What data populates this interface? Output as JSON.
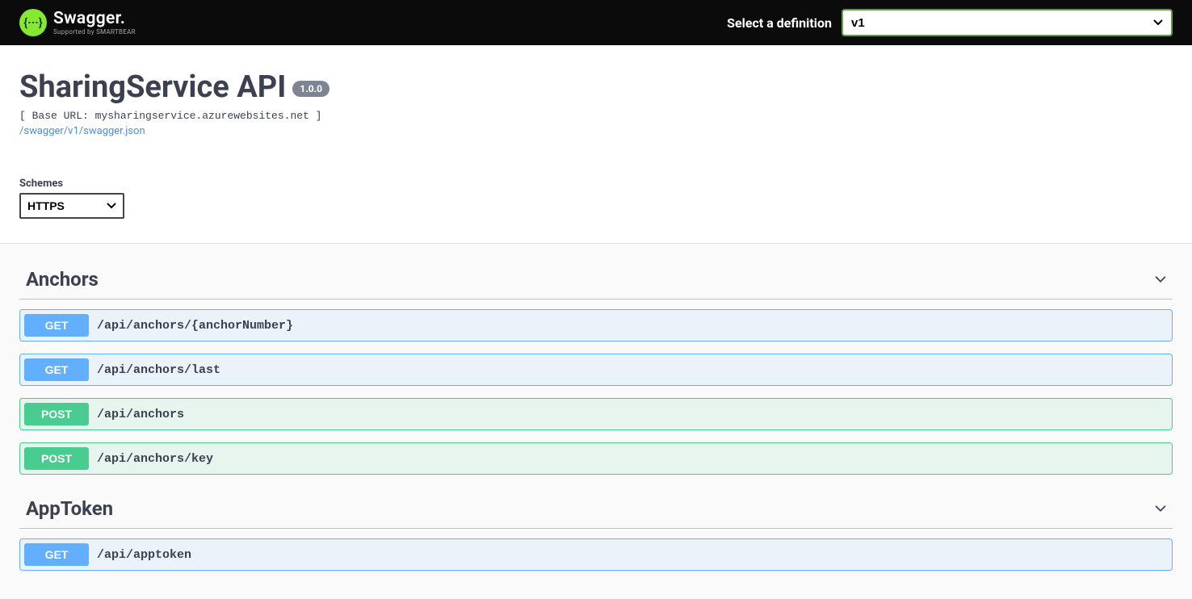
{
  "topbar": {
    "logo_main": "Swagger.",
    "logo_sub": "Supported by SMARTBEAR",
    "logo_glyph": "{···}",
    "definition_label": "Select a definition",
    "definition_selected": "v1"
  },
  "info": {
    "title": "SharingService API",
    "version": "1.0.0",
    "base_url_text": "[ Base URL: mysharingservice.azurewebsites.net ]",
    "swagger_link": "/swagger/v1/swagger.json",
    "schemes_label": "Schemes",
    "schemes_selected": "HTTPS"
  },
  "tags": [
    {
      "name": "Anchors",
      "operations": [
        {
          "method": "GET",
          "method_class": "get",
          "path": "/api/anchors/{anchorNumber}"
        },
        {
          "method": "GET",
          "method_class": "get",
          "path": "/api/anchors/last"
        },
        {
          "method": "POST",
          "method_class": "post",
          "path": "/api/anchors"
        },
        {
          "method": "POST",
          "method_class": "post",
          "path": "/api/anchors/key"
        }
      ]
    },
    {
      "name": "AppToken",
      "operations": [
        {
          "method": "GET",
          "method_class": "get",
          "path": "/api/apptoken"
        }
      ]
    }
  ]
}
